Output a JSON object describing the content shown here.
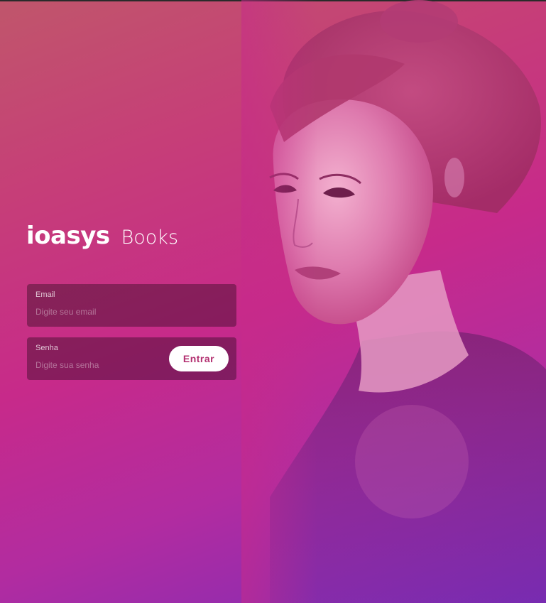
{
  "brand": {
    "logo": "ioasys",
    "product": "Books"
  },
  "login": {
    "email": {
      "label": "Email",
      "placeholder": "Digite seu email",
      "value": ""
    },
    "password": {
      "label": "Senha",
      "placeholder": "Digite sua senha",
      "value": ""
    },
    "submit_label": "Entrar"
  },
  "colors": {
    "gradient_top": "#c0566b",
    "gradient_mid": "#c72a8a",
    "gradient_bottom": "#7d2cb8",
    "button_text": "#b22e6f"
  }
}
